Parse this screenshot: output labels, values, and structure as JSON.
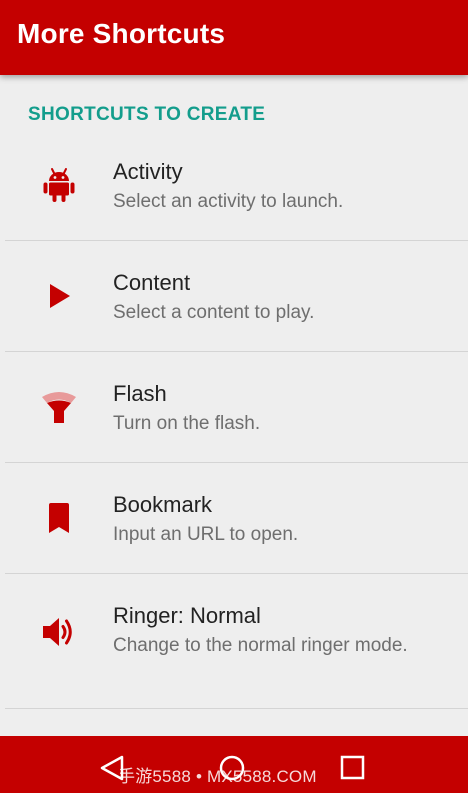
{
  "toolbar": {
    "title": "More Shortcuts"
  },
  "section": {
    "header": "SHORTCUTS TO CREATE"
  },
  "items": [
    {
      "title": "Activity",
      "subtitle": "Select an activity to launch.",
      "icon": "android-icon"
    },
    {
      "title": "Content",
      "subtitle": "Select a content to play.",
      "icon": "play-icon"
    },
    {
      "title": "Flash",
      "subtitle": "Turn on the flash.",
      "icon": "flashlight-icon"
    },
    {
      "title": "Bookmark",
      "subtitle": "Input an URL to open.",
      "icon": "bookmark-icon"
    },
    {
      "title": "Ringer: Normal",
      "subtitle": "Change to the normal ringer mode.",
      "icon": "volume-icon"
    }
  ],
  "navbar": {
    "watermark": "手游5588 • MX5588.COM"
  },
  "colors": {
    "primary": "#c40000",
    "accent": "#139d8c",
    "background": "#eeeeee"
  }
}
